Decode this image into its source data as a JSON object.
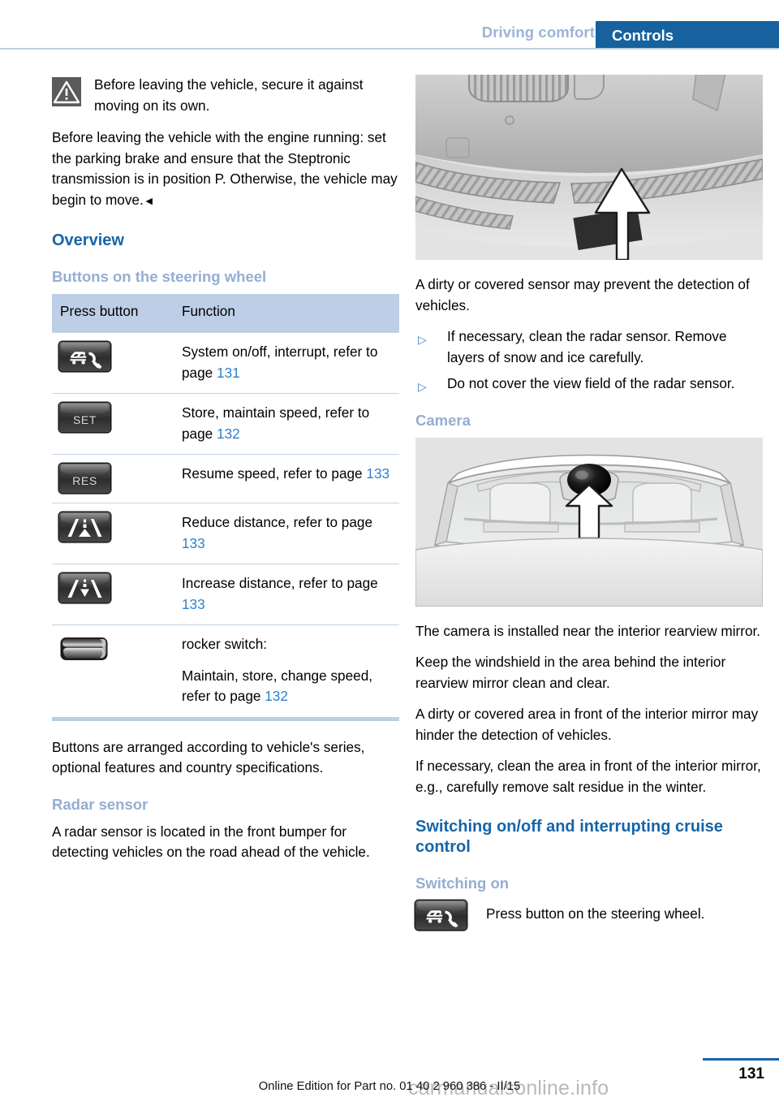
{
  "header": {
    "chapter": "Driving comfort",
    "section": "Controls",
    "accent_blue": "#16619e",
    "muted_blue": "#9bb4d6"
  },
  "left_column": {
    "warning": {
      "icon": "warning-triangle-icon",
      "text": "Before leaving the vehicle, secure it against moving on its own."
    },
    "warning_body": "Before leaving the vehicle with the engine running: set the parking brake and ensure that the Steptronic transmission is in position P. Otherwise, the vehicle may begin to move.",
    "end_mark": "◄",
    "heading_overview": "Overview",
    "heading_buttons": "Buttons on the steering wheel",
    "table": {
      "columns": [
        "Press button",
        "Function"
      ],
      "rows": [
        {
          "icon": "cruise-control-system-icon",
          "icon_label": "",
          "function_lines": [
            {
              "text": "System on/off, interrupt, refer to page ",
              "page": "131"
            }
          ]
        },
        {
          "icon": "set-button-icon",
          "icon_label": "SET",
          "function_lines": [
            {
              "text": "Store, maintain speed, refer to page ",
              "page": "132"
            }
          ]
        },
        {
          "icon": "res-button-icon",
          "icon_label": "RES",
          "function_lines": [
            {
              "text": "Resume speed, refer to page ",
              "page": "133"
            }
          ]
        },
        {
          "icon": "reduce-distance-icon",
          "icon_label": "",
          "function_lines": [
            {
              "text": "Reduce distance, refer to page ",
              "page": "133"
            }
          ]
        },
        {
          "icon": "increase-distance-icon",
          "icon_label": "",
          "function_lines": [
            {
              "text": "Increase distance, refer to page ",
              "page": "133"
            }
          ]
        },
        {
          "icon": "rocker-switch-icon",
          "icon_label": "",
          "function_lines": [
            {
              "text": "rocker switch:",
              "page": ""
            },
            {
              "text": "Maintain, store, change speed, refer to page ",
              "page": "132"
            }
          ]
        }
      ]
    },
    "after_table_text": "Buttons are arranged according to vehicle's series, optional features and country specifications.",
    "heading_radar": "Radar sensor",
    "radar_text": "A radar sensor is located in the front bumper for detecting vehicles on the road ahead of the vehicle."
  },
  "right_column": {
    "figure_radar": {
      "name": "radar-sensor-front-bumper-figure",
      "caption": ""
    },
    "radar_dirty_text": "A dirty or covered sensor may prevent the detection of vehicles.",
    "radar_bullets": [
      "If necessary, clean the radar sensor. Remove layers of snow and ice carefully.",
      "Do not cover the view field of the radar sensor."
    ],
    "bullet_marker": "▷",
    "heading_camera": "Camera",
    "figure_camera": {
      "name": "camera-windshield-figure",
      "caption": ""
    },
    "camera_paragraphs": [
      "The camera is installed near the interior rearview mirror.",
      "Keep the windshield in the area behind the interior rearview mirror clean and clear.",
      "A dirty or covered area in front of the interior mirror may hinder the detection of vehicles.",
      "If necessary, clean the area in front of the interior mirror, e.g., carefully remove salt residue in the winter."
    ],
    "heading_switching": "Switching on/off and interrupting cruise control",
    "heading_switching_on": "Switching on",
    "switching_on": {
      "icon": "cruise-control-system-icon",
      "text": "Press button on the steering wheel."
    }
  },
  "footer": {
    "note": "Online Edition for Part no. 01 40 2 960 386 - II/15",
    "page_number": "131",
    "watermark": "carmanualsonline.info"
  }
}
